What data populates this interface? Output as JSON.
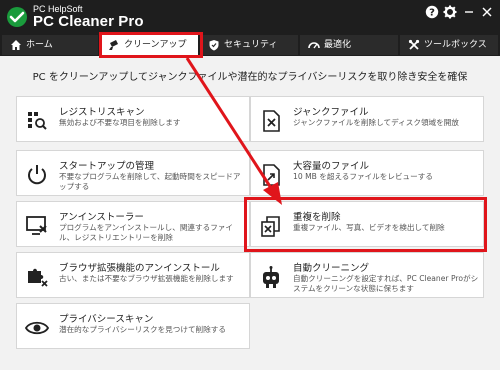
{
  "brand": {
    "small": "PC HelpSoft",
    "name": "PC Cleaner Pro"
  },
  "window_controls": {
    "help": "?",
    "settings": "⚙",
    "minimize": "–",
    "close": "✕"
  },
  "tabs": [
    {
      "label": "ホーム",
      "icon": "home-icon"
    },
    {
      "label": "クリーンアップ",
      "icon": "broom-icon",
      "active": true
    },
    {
      "label": "セキュリティ",
      "icon": "shield-icon"
    },
    {
      "label": "最適化",
      "icon": "speedometer-icon"
    },
    {
      "label": "ツールボックス",
      "icon": "wrench-icon"
    }
  ],
  "headline": "PC をクリーンアップしてジャンクファイルや潜在的なプライバシーリスクを取り除き安全を確保",
  "cards": {
    "registry": {
      "title": "レジストリスキャン",
      "desc": "無効および不要な項目を削除します"
    },
    "startup": {
      "title": "スタートアップの管理",
      "desc": "不要なプログラムを削除して、起動時間をスピードアップする"
    },
    "uninstaller": {
      "title": "アンインストーラー",
      "desc": "プログラムをアンインストールし、関連するファイル、レジストリエントリーを削除"
    },
    "browser_ext": {
      "title": "ブラウザ拡張機能のアンインストール",
      "desc": "古い、または不要なブラウザ拡張機能を削除します"
    },
    "privacy": {
      "title": "プライバシースキャン",
      "desc": "潜在的なプライバシーリスクを見つけて削除する"
    },
    "junk": {
      "title": "ジャンクファイル",
      "desc": "ジャンクファイルを削除してディスク領域を開放"
    },
    "large_files": {
      "title": "大容量のファイル",
      "desc": "10 MB を超えるファイルをレビューする"
    },
    "duplicates": {
      "title": "重複を削除",
      "desc": "重複ファイル、写真、ビデオを検出して削除"
    },
    "auto_clean": {
      "title": "自動クリーニング",
      "desc": "自動クリーニングを設定すれば、PC Cleaner Proがシステムをクリーンな状態に保ちます"
    }
  },
  "colors": {
    "accent": "#e0151b",
    "titlebar": "#1e1e1e",
    "tab": "#2b2b2b",
    "content": "#f2f2f2"
  }
}
